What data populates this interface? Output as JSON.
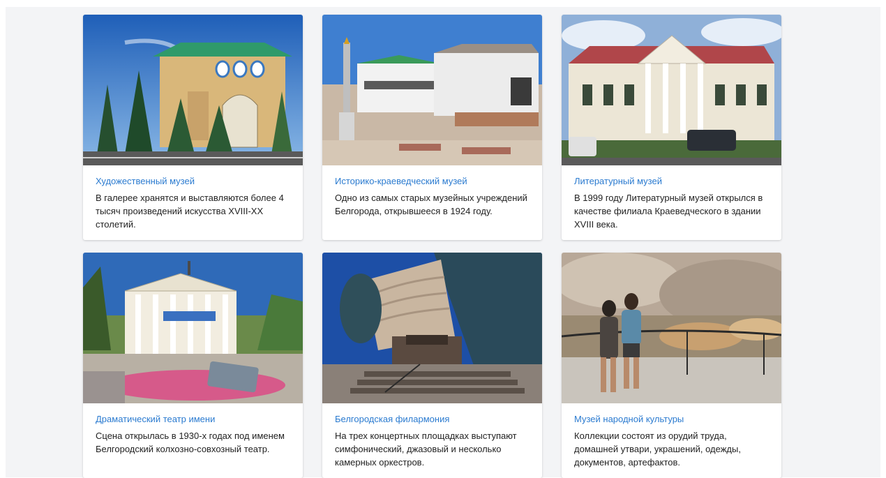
{
  "cards": [
    {
      "title": "Художественный музей",
      "text": "В галерее хранятся и выставляются более 4 тысяч произведений искусства XVIII-XX столетий."
    },
    {
      "title": "Историко-краеведческий музей",
      "text": "Одно из самых старых музейных учреждений Белгорода, открывшееся в 1924 году."
    },
    {
      "title": "Литературный музей",
      "text": "В 1999 году Литературный музей открылся в качестве филиала Краеведческого в здании XVIII века."
    },
    {
      "title": "Драматический театр имени",
      "text": "Сцена открылась в 1930-х годах под именем Белгородский колхозно-совхозный театр."
    },
    {
      "title": "Белгородская филармония",
      "text": "На трех концертных площадках выступают симфонический, джазовый и несколько камерных оркестров."
    },
    {
      "title": "Музей народной культуры",
      "text": "Коллекции состоят из орудий труда, домашней утвари, украшений, одежды, документов, артефактов."
    }
  ]
}
